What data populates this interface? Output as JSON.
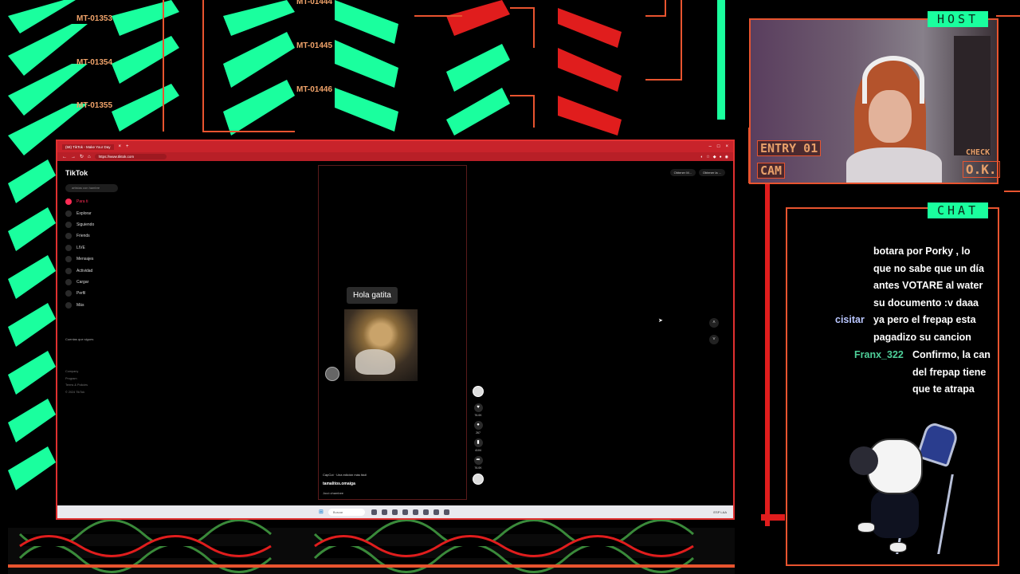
{
  "overlay": {
    "mt_labels": [
      "MT-01353",
      "MT-01354",
      "MT-01355",
      "MT-01444",
      "MT-01445",
      "MT-01446"
    ],
    "host_label": "HOST",
    "entry_label": "ENTRY 01",
    "cam_label": "CAM",
    "check_label": "CHECK",
    "ok_label": "O.K.",
    "chat_label": "CHAT"
  },
  "browser": {
    "tab_title": "(58) TikTok - Make Your Day",
    "url": "https://www.tiktok.com",
    "tiktok": {
      "logo": "TikTok",
      "search_placeholder": "artistas con hambre",
      "nav": [
        {
          "label": "Para ti",
          "icon": "home-icon"
        },
        {
          "label": "Explorar",
          "icon": "compass-icon"
        },
        {
          "label": "Siguiendo",
          "icon": "following-icon"
        },
        {
          "label": "Friends",
          "icon": "friends-icon"
        },
        {
          "label": "LIVE",
          "icon": "live-icon"
        },
        {
          "label": "Mensajes",
          "icon": "messages-icon"
        },
        {
          "label": "Actividad",
          "icon": "activity-icon"
        },
        {
          "label": "Cargar",
          "icon": "upload-icon"
        },
        {
          "label": "Perfil",
          "icon": "profile-icon"
        },
        {
          "label": "Más",
          "icon": "more-icon"
        }
      ],
      "following_title": "Cuentas que sigues",
      "footer": [
        "Company",
        "Program",
        "Terms & Policies",
        "© 2024 TikTok"
      ],
      "top_buttons": [
        "Obtener M...",
        "Obtener la ..."
      ],
      "video": {
        "bubble_text": "Hola gatita",
        "capcut": "CapCut · Una edición más fácil",
        "author": "tamalitos.omaiga",
        "sound": "Jocó chambee"
      },
      "actions": [
        {
          "icon": "heart-icon",
          "count": "76.0K"
        },
        {
          "icon": "comment-icon",
          "count": "267"
        },
        {
          "icon": "bookmark-icon",
          "count": "4104"
        },
        {
          "icon": "share-icon",
          "count": "76.0K"
        }
      ]
    },
    "taskbar": {
      "search": "Buscar",
      "tray": "ESP LAA"
    }
  },
  "chat": {
    "messages": [
      {
        "user": "",
        "lines": [
          "botara por Porky , lo",
          "que no sabe que un día",
          "antes VOTARE al water",
          "su documento :v daaa"
        ]
      },
      {
        "user": "cisitar",
        "user_color": "#b9c6ff",
        "lines": [
          "ya pero el frepap esta",
          "pagadizo su cancion"
        ]
      },
      {
        "user": "Franx_322",
        "user_color": "#4ecf99",
        "lines": [
          "Confirmo, la can",
          "del frepap tiene",
          "que te atrapa"
        ]
      }
    ]
  }
}
